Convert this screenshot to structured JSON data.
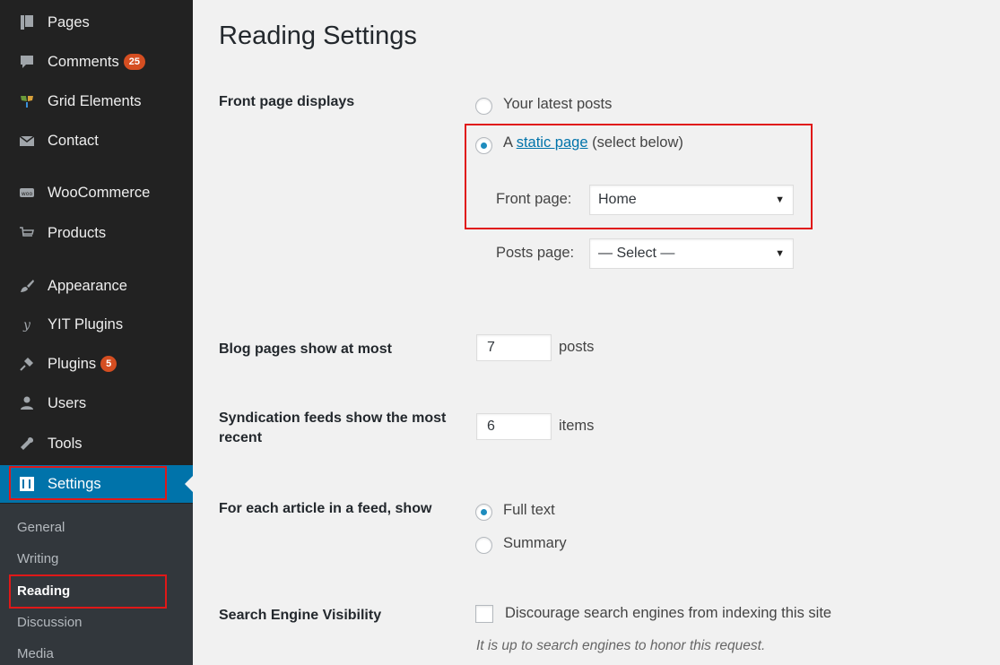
{
  "sidebar": {
    "items": [
      {
        "label": "Pages",
        "icon": "pages-icon"
      },
      {
        "label": "Comments",
        "icon": "comments-icon",
        "badge": "25"
      },
      {
        "label": "Grid Elements",
        "icon": "grid-elements-icon"
      },
      {
        "label": "Contact",
        "icon": "envelope-icon"
      },
      {
        "label": "WooCommerce",
        "icon": "woocommerce-icon"
      },
      {
        "label": "Products",
        "icon": "cart-icon"
      },
      {
        "label": "Appearance",
        "icon": "paintbrush-icon"
      },
      {
        "label": "YIT Plugins",
        "icon": "yit-icon"
      },
      {
        "label": "Plugins",
        "icon": "plug-icon",
        "badge": "5"
      },
      {
        "label": "Users",
        "icon": "users-icon"
      },
      {
        "label": "Tools",
        "icon": "wrench-icon"
      },
      {
        "label": "Settings",
        "icon": "settings-icon"
      }
    ],
    "submenu": [
      "General",
      "Writing",
      "Reading",
      "Discussion",
      "Media"
    ],
    "accent_color": "#0073aa",
    "badge_color": "#d54e21"
  },
  "main": {
    "title": "Reading Settings",
    "front_page": {
      "label": "Front page displays",
      "option_latest": "Your latest posts",
      "option_static_prefix": "A",
      "option_static_link": "static page",
      "option_static_suffix": "(select below)",
      "front_page_label": "Front page:",
      "front_page_value": "Home",
      "posts_page_label": "Posts page:",
      "posts_page_value": "— Select —"
    },
    "blog_pages": {
      "label": "Blog pages show at most",
      "value": "7",
      "unit": "posts"
    },
    "syndication": {
      "label": "Syndication feeds show the most recent",
      "value": "6",
      "unit": "items"
    },
    "feed_article": {
      "label": "For each article in a feed, show",
      "option_full": "Full text",
      "option_summary": "Summary"
    },
    "search_visibility": {
      "label": "Search Engine Visibility",
      "checkbox_label": "Discourage search engines from indexing this site",
      "hint": "It is up to search engines to honor this request."
    },
    "highlight_color": "#e01818"
  }
}
